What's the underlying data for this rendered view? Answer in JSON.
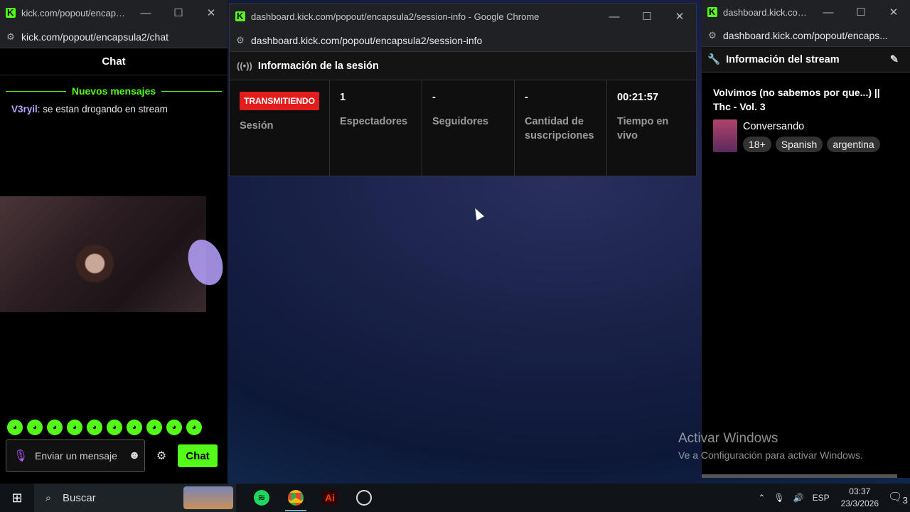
{
  "chat_window": {
    "title": "kick.com/popout/encapsula...",
    "url": "kick.com/popout/encapsula2/chat",
    "header": "Chat",
    "new_messages": "Nuevos mensajes",
    "messages": [
      {
        "user": "V3ryil",
        "text": ": se estan drogando en stream"
      }
    ],
    "input_placeholder": "Enviar un mensaje",
    "send_label": "Chat"
  },
  "session_window": {
    "title": "dashboard.kick.com/popout/encapsula2/session-info - Google Chrome",
    "url": "dashboard.kick.com/popout/encapsula2/session-info",
    "header": "Información de la sesión",
    "status_badge": "TRANSMITIENDO",
    "status_label": "Sesión",
    "viewers_value": "1",
    "viewers_label": "Espectadores",
    "followers_value": "-",
    "followers_label": "Seguidores",
    "subs_value": "-",
    "subs_label": "Cantidad de suscripciones",
    "uptime_value": "00:21:57",
    "uptime_label": "Tiempo en vivo"
  },
  "stream_window": {
    "title": "dashboard.kick.com/p...",
    "url": "dashboard.kick.com/popout/encaps...",
    "header": "Información del stream",
    "stream_title": "Volvimos (no sabemos por que...) || Thc - Vol. 3",
    "category": "Conversando",
    "tags": [
      "18+",
      "Spanish",
      "argentina"
    ]
  },
  "desktop": {
    "watermark_title": "Activar Windows",
    "watermark_sub": "Ve a Configuración para activar Windows."
  },
  "taskbar": {
    "search_label": "Buscar",
    "language": "ESP",
    "time": "03:37",
    "date": "23/3/2026",
    "notification_count": "3"
  },
  "colors": {
    "kick_green": "#53fc18",
    "live_red": "#e31c1c",
    "username": "#b9a3ff"
  }
}
